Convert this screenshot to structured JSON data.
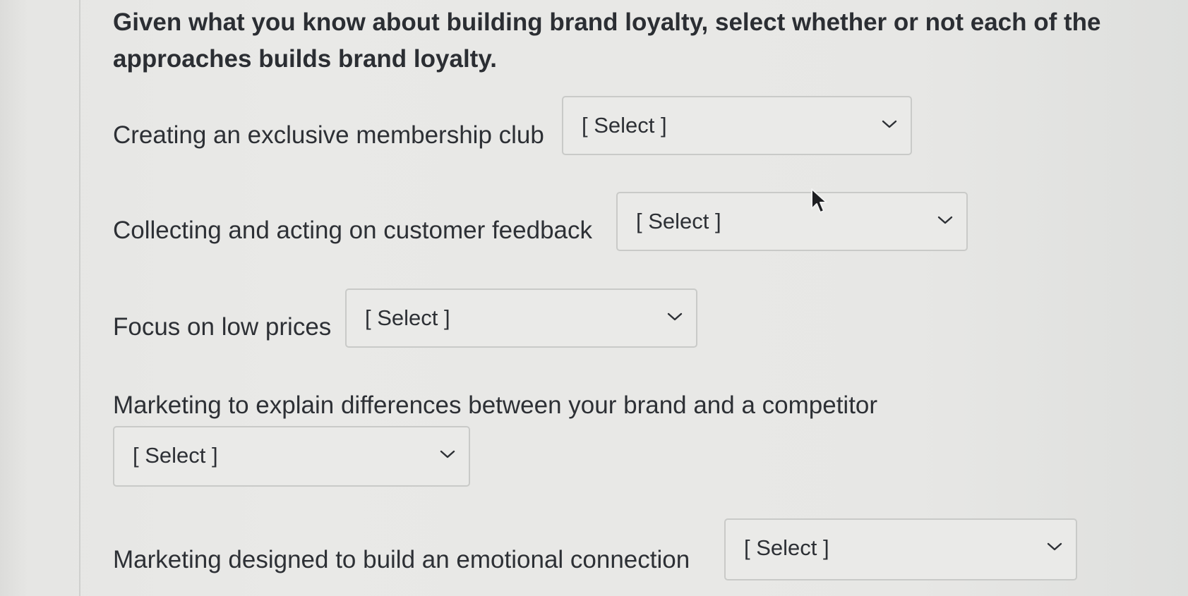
{
  "question": "Given what you know about building brand loyalty, select whether or not each of the approaches builds brand loyalty.",
  "rows": [
    {
      "label": "Creating an exclusive membership club",
      "selected": "[ Select ]"
    },
    {
      "label": "Collecting and acting on customer feedback",
      "selected": "[ Select ]"
    },
    {
      "label": "Focus on low prices",
      "selected": "[ Select ]"
    },
    {
      "label": "Marketing to explain differences between your brand and a competitor",
      "selected": "[ Select ]"
    },
    {
      "label": "Marketing designed to build an emotional connection",
      "selected": "[ Select ]"
    }
  ],
  "icons": {
    "dropdown": "chevron-down-icon",
    "cursor": "mouse-pointer-icon"
  },
  "colors": {
    "background": "#e7e7e5",
    "text": "#2c2f33",
    "border": "#c9cac8"
  }
}
